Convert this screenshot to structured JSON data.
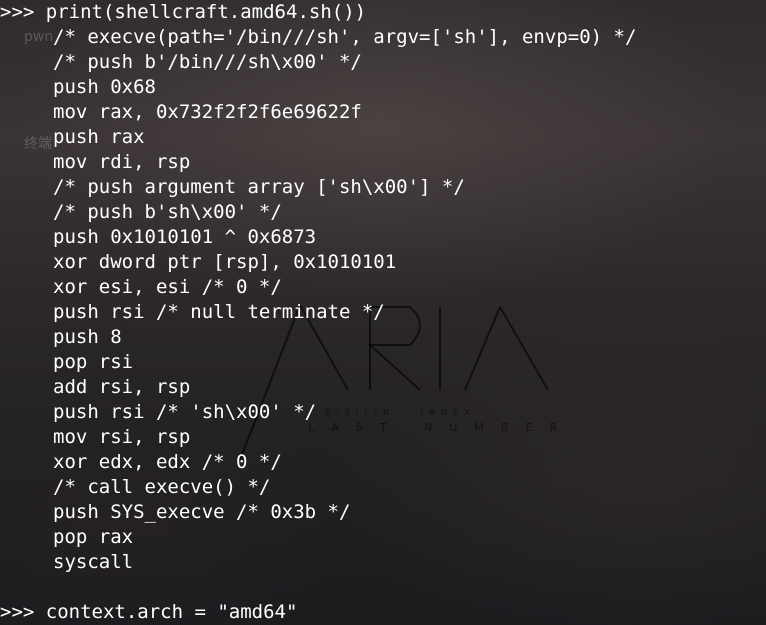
{
  "terminal": {
    "prompt": ">>>",
    "command": "print(shellcraft.amd64.sh())",
    "output_lines": [
      "/* execve(path='/bin///sh', argv=['sh'], envp=0) */",
      "/* push b'/bin///sh\\x00' */",
      "push 0x68",
      "mov rax, 0x732f2f2f6e69622f",
      "push rax",
      "mov rdi, rsp",
      "/* push argument array ['sh\\x00'] */",
      "/* push b'sh\\x00' */",
      "push 0x1010101 ^ 0x6873",
      "xor dword ptr [rsp], 0x1010101",
      "xor esi, esi /* 0 */",
      "push rsi /* null terminate */",
      "push 8",
      "pop rsi",
      "add rsi, rsp",
      "push rsi /* 'sh\\x00' */",
      "mov rsi, rsp",
      "xor edx, edx /* 0 */",
      "/* call execve() */",
      "push SYS_execve /* 0x3b */",
      "pop rax",
      "syscall"
    ],
    "next_command": "context.arch = \"amd64\""
  },
  "desktop": {
    "label_1": "pwn",
    "label_2": "终端"
  },
  "wallpaper": {
    "logo_text": "ARIA",
    "subtitle_small": "BISILIN · INDEX",
    "subtitle": "LAST NUMBER"
  }
}
